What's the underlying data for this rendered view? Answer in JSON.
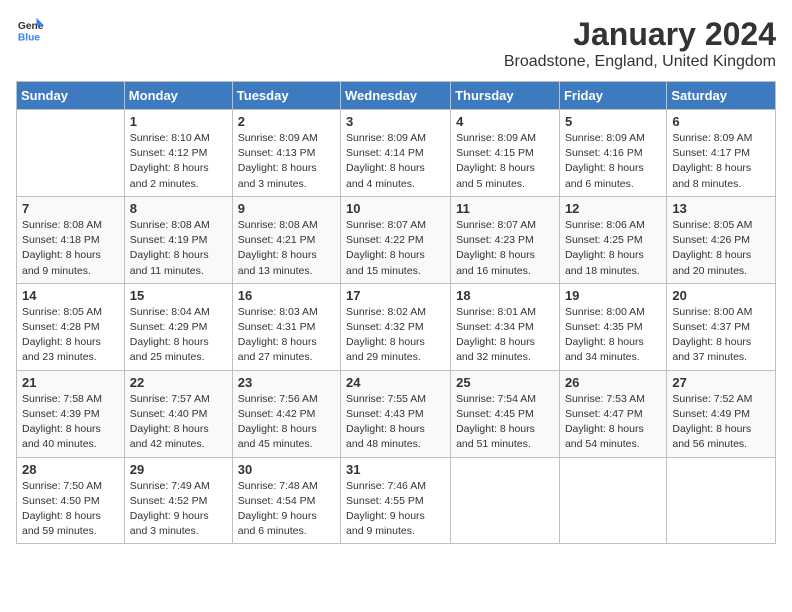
{
  "header": {
    "logo_general": "General",
    "logo_blue": "Blue",
    "month_year": "January 2024",
    "location": "Broadstone, England, United Kingdom"
  },
  "days_of_week": [
    "Sunday",
    "Monday",
    "Tuesday",
    "Wednesday",
    "Thursday",
    "Friday",
    "Saturday"
  ],
  "weeks": [
    [
      {
        "day": "",
        "sunrise": "",
        "sunset": "",
        "daylight": ""
      },
      {
        "day": "1",
        "sunrise": "Sunrise: 8:10 AM",
        "sunset": "Sunset: 4:12 PM",
        "daylight": "Daylight: 8 hours and 2 minutes."
      },
      {
        "day": "2",
        "sunrise": "Sunrise: 8:09 AM",
        "sunset": "Sunset: 4:13 PM",
        "daylight": "Daylight: 8 hours and 3 minutes."
      },
      {
        "day": "3",
        "sunrise": "Sunrise: 8:09 AM",
        "sunset": "Sunset: 4:14 PM",
        "daylight": "Daylight: 8 hours and 4 minutes."
      },
      {
        "day": "4",
        "sunrise": "Sunrise: 8:09 AM",
        "sunset": "Sunset: 4:15 PM",
        "daylight": "Daylight: 8 hours and 5 minutes."
      },
      {
        "day": "5",
        "sunrise": "Sunrise: 8:09 AM",
        "sunset": "Sunset: 4:16 PM",
        "daylight": "Daylight: 8 hours and 6 minutes."
      },
      {
        "day": "6",
        "sunrise": "Sunrise: 8:09 AM",
        "sunset": "Sunset: 4:17 PM",
        "daylight": "Daylight: 8 hours and 8 minutes."
      }
    ],
    [
      {
        "day": "7",
        "sunrise": "Sunrise: 8:08 AM",
        "sunset": "Sunset: 4:18 PM",
        "daylight": "Daylight: 8 hours and 9 minutes."
      },
      {
        "day": "8",
        "sunrise": "Sunrise: 8:08 AM",
        "sunset": "Sunset: 4:19 PM",
        "daylight": "Daylight: 8 hours and 11 minutes."
      },
      {
        "day": "9",
        "sunrise": "Sunrise: 8:08 AM",
        "sunset": "Sunset: 4:21 PM",
        "daylight": "Daylight: 8 hours and 13 minutes."
      },
      {
        "day": "10",
        "sunrise": "Sunrise: 8:07 AM",
        "sunset": "Sunset: 4:22 PM",
        "daylight": "Daylight: 8 hours and 15 minutes."
      },
      {
        "day": "11",
        "sunrise": "Sunrise: 8:07 AM",
        "sunset": "Sunset: 4:23 PM",
        "daylight": "Daylight: 8 hours and 16 minutes."
      },
      {
        "day": "12",
        "sunrise": "Sunrise: 8:06 AM",
        "sunset": "Sunset: 4:25 PM",
        "daylight": "Daylight: 8 hours and 18 minutes."
      },
      {
        "day": "13",
        "sunrise": "Sunrise: 8:05 AM",
        "sunset": "Sunset: 4:26 PM",
        "daylight": "Daylight: 8 hours and 20 minutes."
      }
    ],
    [
      {
        "day": "14",
        "sunrise": "Sunrise: 8:05 AM",
        "sunset": "Sunset: 4:28 PM",
        "daylight": "Daylight: 8 hours and 23 minutes."
      },
      {
        "day": "15",
        "sunrise": "Sunrise: 8:04 AM",
        "sunset": "Sunset: 4:29 PM",
        "daylight": "Daylight: 8 hours and 25 minutes."
      },
      {
        "day": "16",
        "sunrise": "Sunrise: 8:03 AM",
        "sunset": "Sunset: 4:31 PM",
        "daylight": "Daylight: 8 hours and 27 minutes."
      },
      {
        "day": "17",
        "sunrise": "Sunrise: 8:02 AM",
        "sunset": "Sunset: 4:32 PM",
        "daylight": "Daylight: 8 hours and 29 minutes."
      },
      {
        "day": "18",
        "sunrise": "Sunrise: 8:01 AM",
        "sunset": "Sunset: 4:34 PM",
        "daylight": "Daylight: 8 hours and 32 minutes."
      },
      {
        "day": "19",
        "sunrise": "Sunrise: 8:00 AM",
        "sunset": "Sunset: 4:35 PM",
        "daylight": "Daylight: 8 hours and 34 minutes."
      },
      {
        "day": "20",
        "sunrise": "Sunrise: 8:00 AM",
        "sunset": "Sunset: 4:37 PM",
        "daylight": "Daylight: 8 hours and 37 minutes."
      }
    ],
    [
      {
        "day": "21",
        "sunrise": "Sunrise: 7:58 AM",
        "sunset": "Sunset: 4:39 PM",
        "daylight": "Daylight: 8 hours and 40 minutes."
      },
      {
        "day": "22",
        "sunrise": "Sunrise: 7:57 AM",
        "sunset": "Sunset: 4:40 PM",
        "daylight": "Daylight: 8 hours and 42 minutes."
      },
      {
        "day": "23",
        "sunrise": "Sunrise: 7:56 AM",
        "sunset": "Sunset: 4:42 PM",
        "daylight": "Daylight: 8 hours and 45 minutes."
      },
      {
        "day": "24",
        "sunrise": "Sunrise: 7:55 AM",
        "sunset": "Sunset: 4:43 PM",
        "daylight": "Daylight: 8 hours and 48 minutes."
      },
      {
        "day": "25",
        "sunrise": "Sunrise: 7:54 AM",
        "sunset": "Sunset: 4:45 PM",
        "daylight": "Daylight: 8 hours and 51 minutes."
      },
      {
        "day": "26",
        "sunrise": "Sunrise: 7:53 AM",
        "sunset": "Sunset: 4:47 PM",
        "daylight": "Daylight: 8 hours and 54 minutes."
      },
      {
        "day": "27",
        "sunrise": "Sunrise: 7:52 AM",
        "sunset": "Sunset: 4:49 PM",
        "daylight": "Daylight: 8 hours and 56 minutes."
      }
    ],
    [
      {
        "day": "28",
        "sunrise": "Sunrise: 7:50 AM",
        "sunset": "Sunset: 4:50 PM",
        "daylight": "Daylight: 8 hours and 59 minutes."
      },
      {
        "day": "29",
        "sunrise": "Sunrise: 7:49 AM",
        "sunset": "Sunset: 4:52 PM",
        "daylight": "Daylight: 9 hours and 3 minutes."
      },
      {
        "day": "30",
        "sunrise": "Sunrise: 7:48 AM",
        "sunset": "Sunset: 4:54 PM",
        "daylight": "Daylight: 9 hours and 6 minutes."
      },
      {
        "day": "31",
        "sunrise": "Sunrise: 7:46 AM",
        "sunset": "Sunset: 4:55 PM",
        "daylight": "Daylight: 9 hours and 9 minutes."
      },
      {
        "day": "",
        "sunrise": "",
        "sunset": "",
        "daylight": ""
      },
      {
        "day": "",
        "sunrise": "",
        "sunset": "",
        "daylight": ""
      },
      {
        "day": "",
        "sunrise": "",
        "sunset": "",
        "daylight": ""
      }
    ]
  ]
}
